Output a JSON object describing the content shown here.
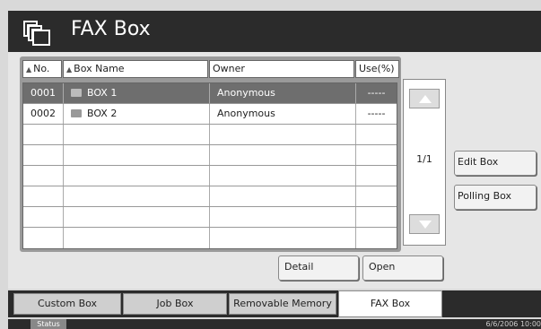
{
  "header": {
    "title": "FAX Box",
    "icon": "box-stack-icon"
  },
  "table": {
    "columns": [
      "No.",
      "Box Name",
      "Owner",
      "Use(%)"
    ],
    "rows": [
      {
        "no": "0001",
        "name": "BOX 1",
        "owner": "Anonymous",
        "use": "-----",
        "selected": true
      },
      {
        "no": "0002",
        "name": "BOX 2",
        "owner": "Anonymous",
        "use": "-----",
        "selected": false
      }
    ],
    "page": "1/1"
  },
  "side_buttons": {
    "edit": "Edit Box",
    "polling": "Polling Box"
  },
  "actions": {
    "detail": "Detail",
    "open": "Open"
  },
  "tabs": [
    "Custom Box",
    "Job Box",
    "Removable Memory",
    "FAX Box"
  ],
  "active_tab": "FAX Box",
  "status": {
    "label": "Status",
    "datetime": "6/6/2006 10:00"
  }
}
